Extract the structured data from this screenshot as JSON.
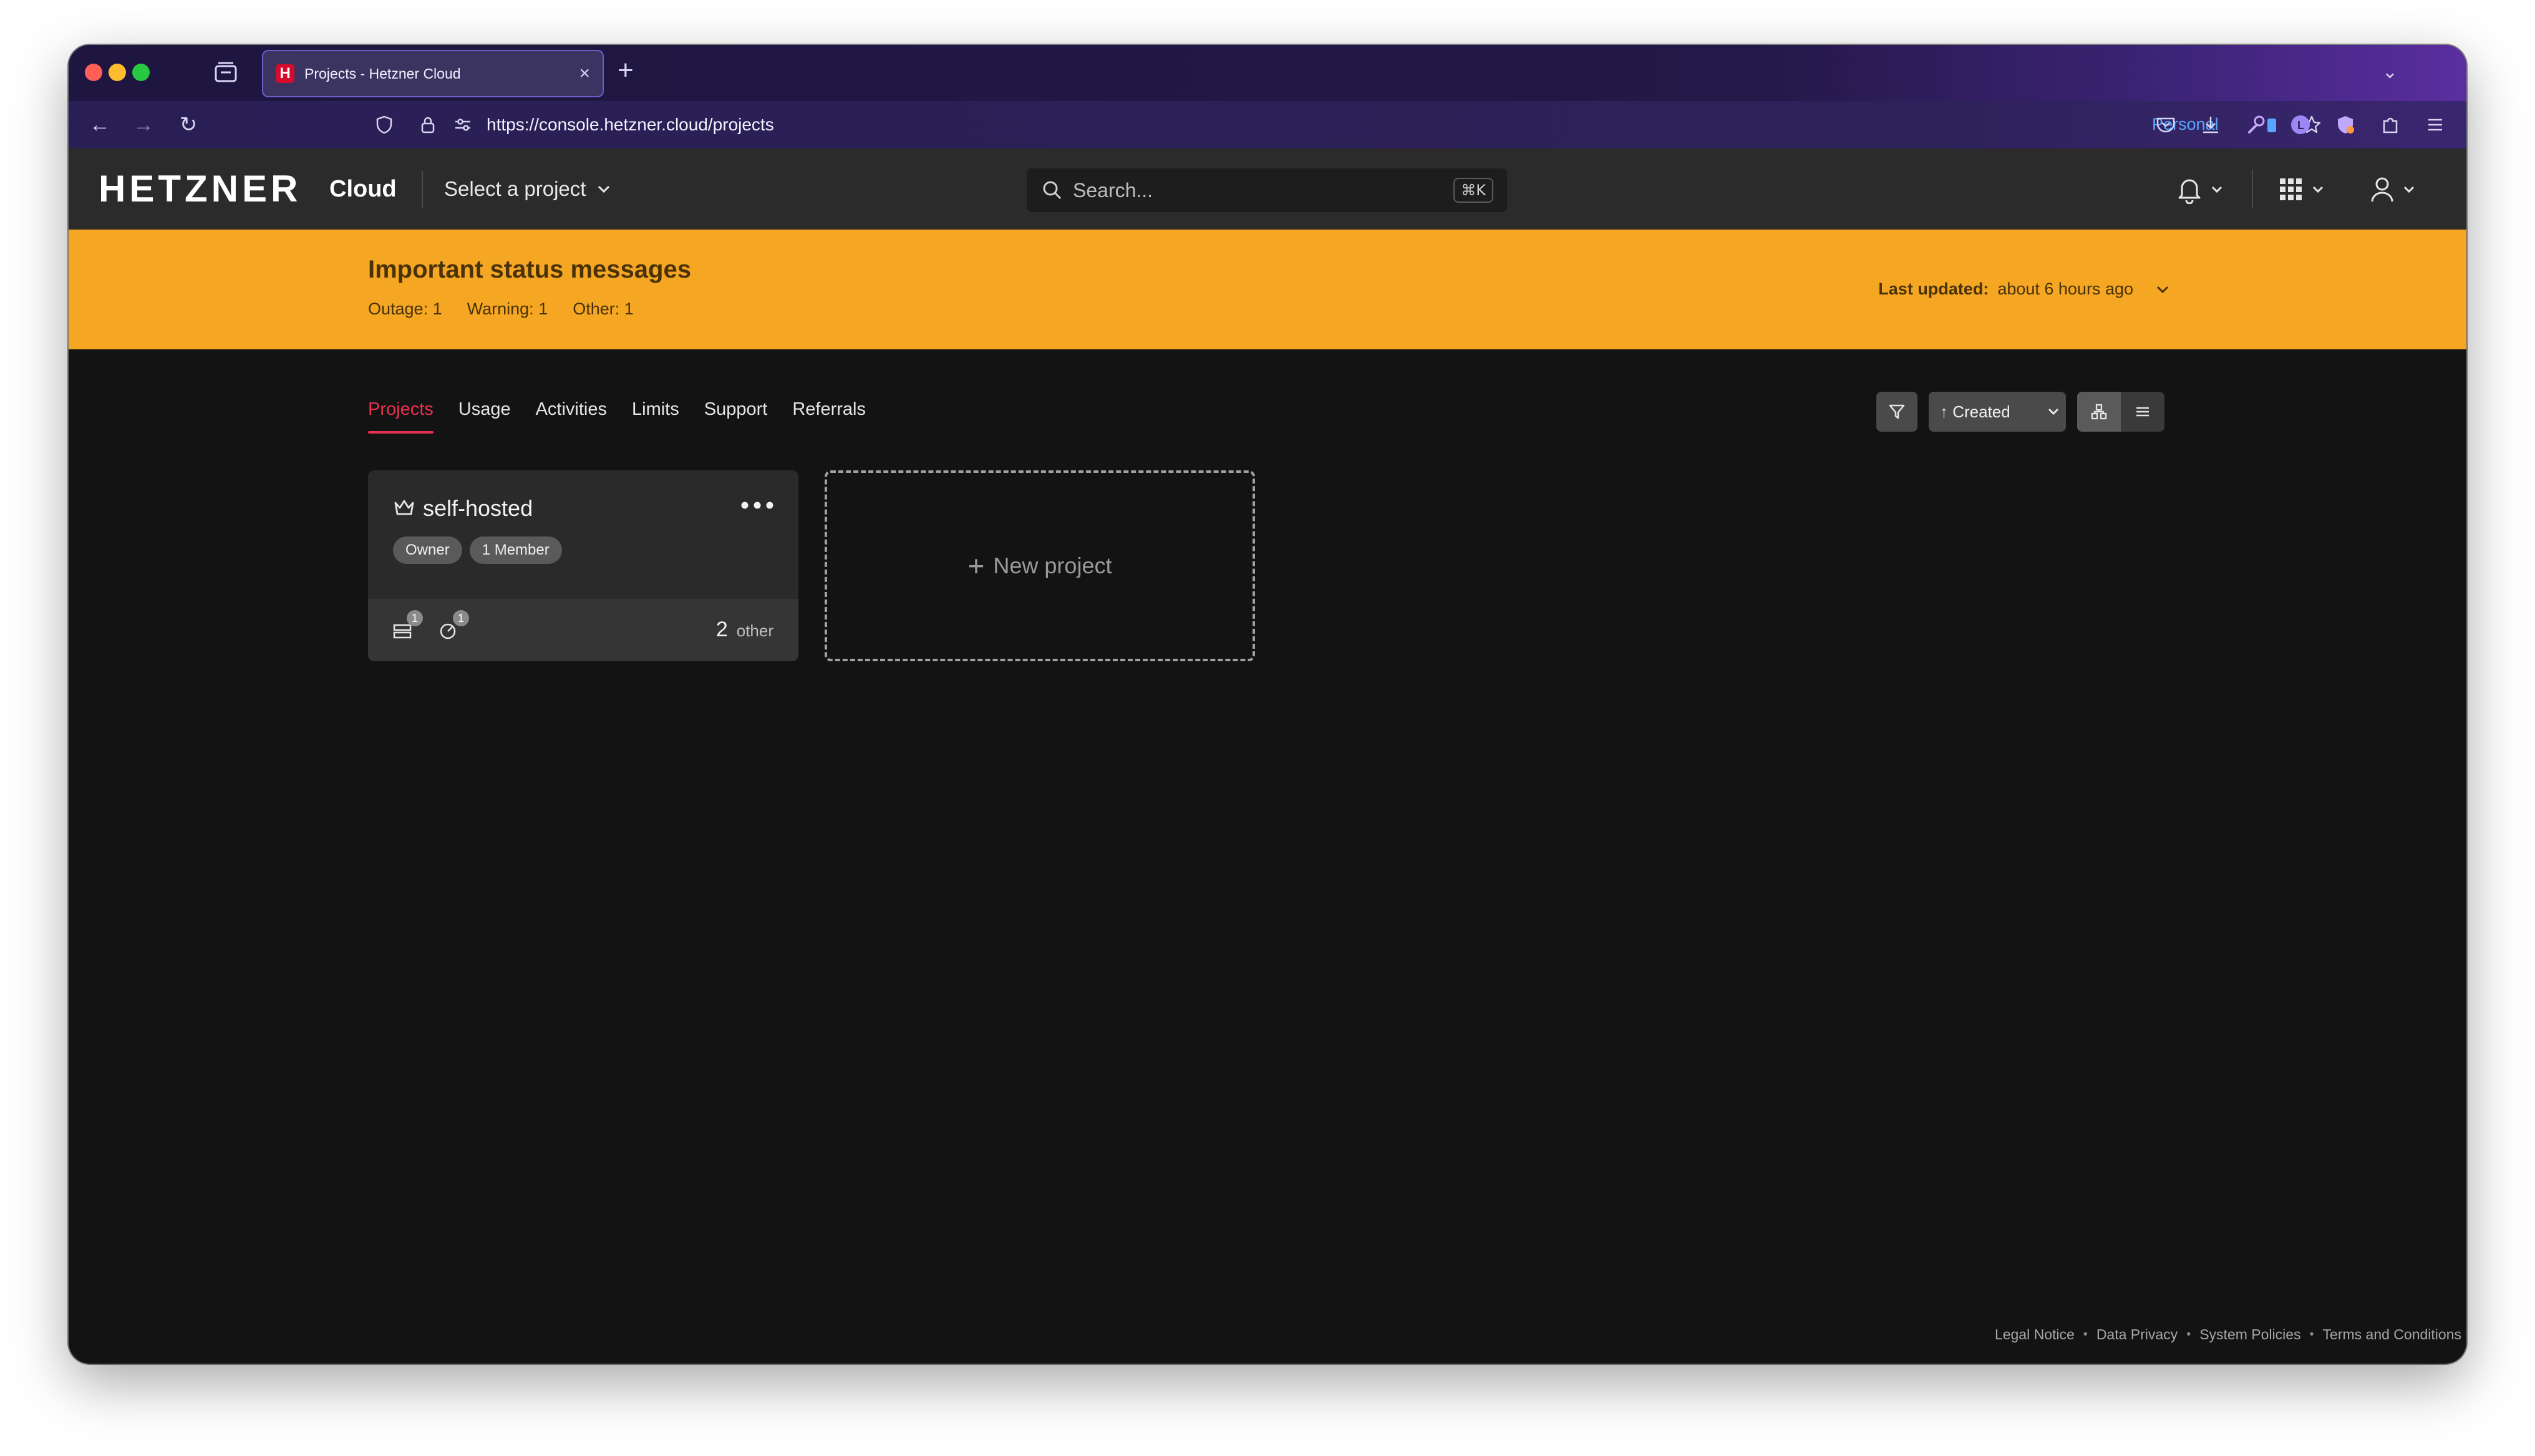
{
  "browser": {
    "tab_title": "Projects - Hetzner Cloud",
    "favicon_letter": "H",
    "url": "https://console.hetzner.cloud/projects",
    "profile_label": "Personal"
  },
  "header": {
    "logo": "HETZNER",
    "product": "Cloud",
    "project_selector": "Select a project",
    "search_placeholder": "Search...",
    "search_shortcut": "⌘K"
  },
  "status_banner": {
    "title": "Important status messages",
    "counts": [
      {
        "label": "Outage:",
        "value": "1"
      },
      {
        "label": "Warning:",
        "value": "1"
      },
      {
        "label": "Other:",
        "value": "1"
      }
    ],
    "last_updated_label": "Last updated:",
    "last_updated_value": "about 6 hours ago"
  },
  "nav_tabs": [
    {
      "label": "Projects",
      "active": true
    },
    {
      "label": "Usage",
      "active": false
    },
    {
      "label": "Activities",
      "active": false
    },
    {
      "label": "Limits",
      "active": false
    },
    {
      "label": "Support",
      "active": false
    },
    {
      "label": "Referrals",
      "active": false
    }
  ],
  "toolbar": {
    "sort_label": "↑ Created"
  },
  "projects": [
    {
      "name": "self-hosted",
      "badges": [
        "Owner",
        "1 Member"
      ],
      "servers_count": "1",
      "volumes_count": "1",
      "other_count": "2",
      "other_label": "other"
    }
  ],
  "new_project": {
    "icon": "+",
    "label": "New project"
  },
  "footer": {
    "links": [
      "Legal Notice",
      "Data Privacy",
      "System Policies",
      "Terms and Conditions"
    ]
  },
  "colors": {
    "accent": "#e8304f",
    "banner": "#f5a623",
    "background": "#131313"
  }
}
